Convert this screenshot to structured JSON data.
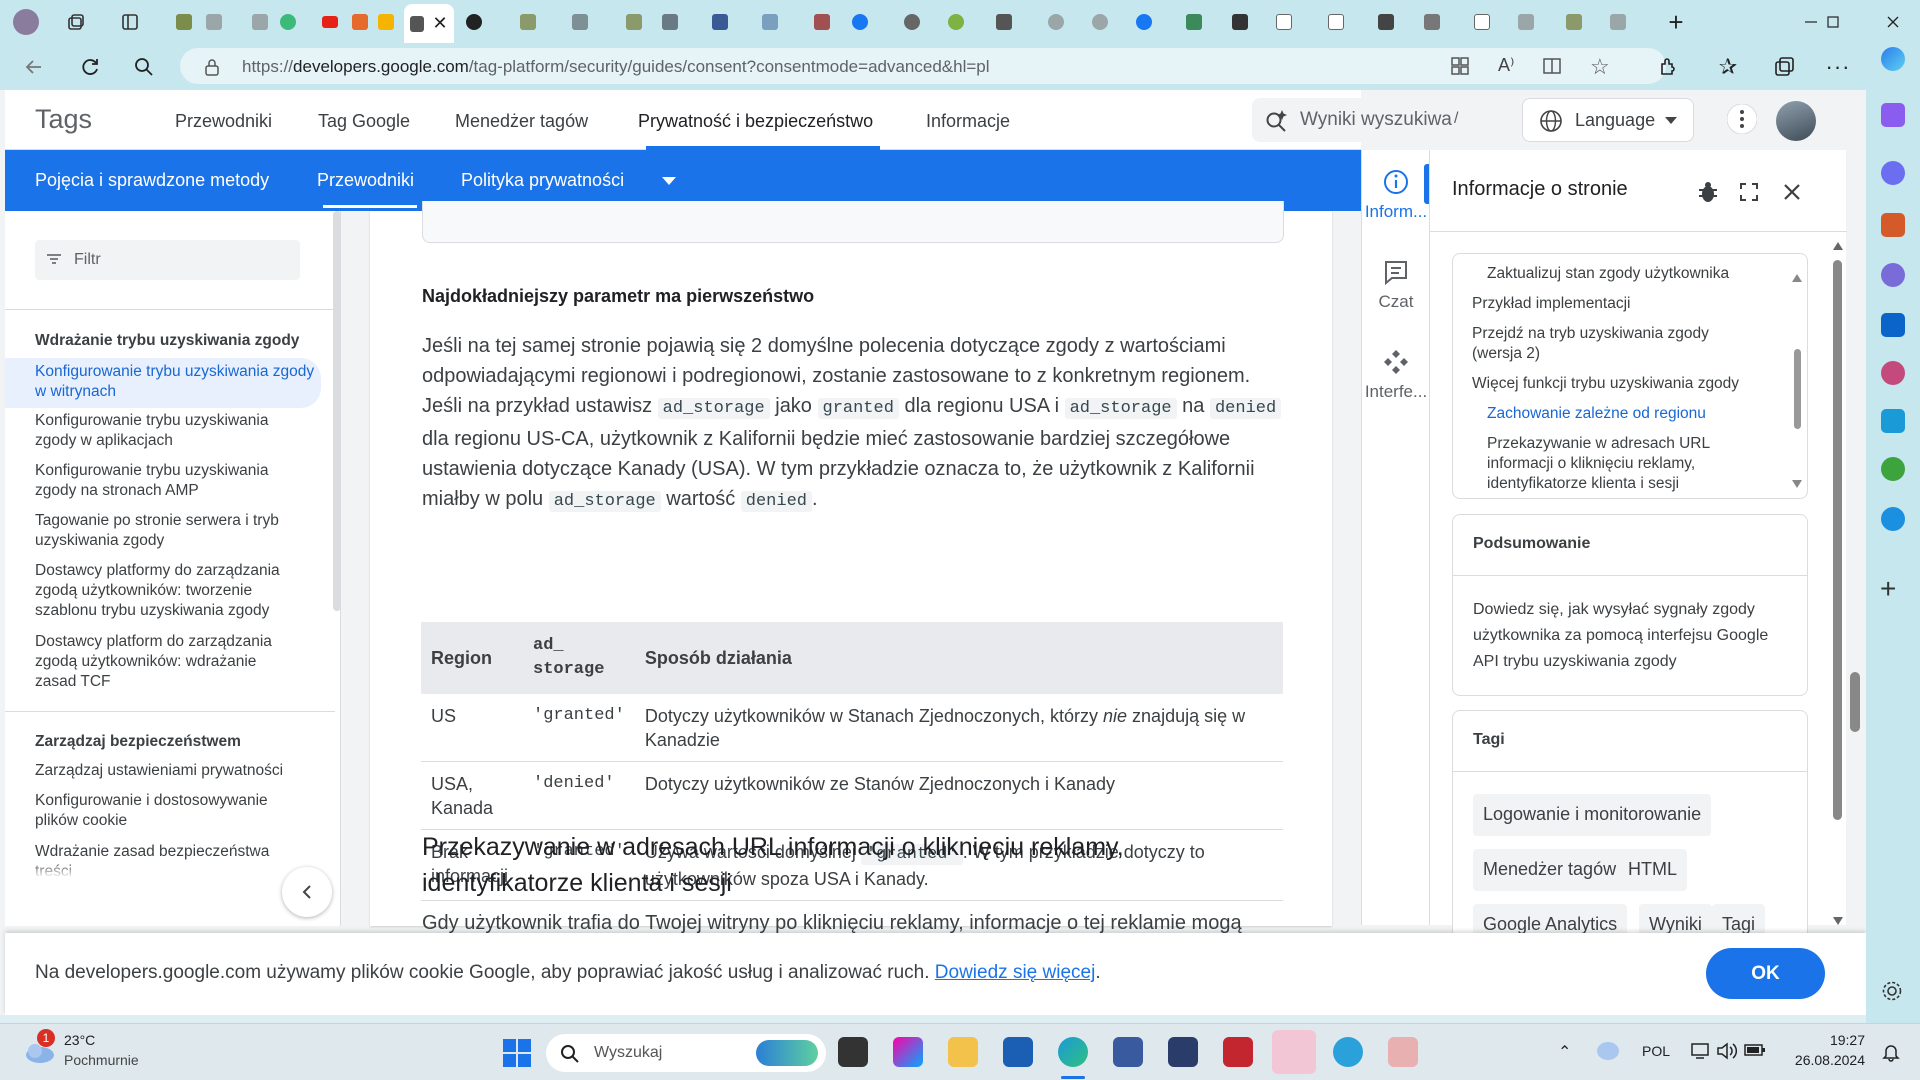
{
  "browser": {
    "url_prefix": "https://",
    "url_domain": "developers.google.com",
    "url_rest": "/tag-platform/security/guides/consent?consentmode=advanced&hl=pl"
  },
  "site": {
    "brand": "Tags",
    "top_nav": [
      "Przewodniki",
      "Tag Google",
      "Menedżer tagów",
      "Prywatność i bezpieczeństwo",
      "Informacje"
    ],
    "search_placeholder": "Wyniki wyszukiwa",
    "search_shortcut": "/",
    "language_label": "Language",
    "sub_nav": [
      "Pojęcia i sprawdzone metody",
      "Przewodniki",
      "Polityka prywatności"
    ]
  },
  "left_nav": {
    "filter_placeholder": "Filtr",
    "section1_title": "Wdrażanie trybu uzyskiwania zgody",
    "section1_items": [
      "Konfigurowanie trybu uzyskiwania zgody w witrynach",
      "Konfigurowanie trybu uzyskiwania zgody w aplikacjach",
      "Konfigurowanie trybu uzyskiwania zgody na stronach AMP",
      "Tagowanie po stronie serwera i tryb uzyskiwania zgody",
      "Dostawcy platformy do zarządzania zgodą użytkowników: tworzenie szablonu trybu uzyskiwania zgody",
      "Dostawcy platform do zarządzania zgodą użytkowników: wdrażanie zasad TCF"
    ],
    "section2_title": "Zarządzaj bezpieczeństwem",
    "section2_items": [
      "Zarządzaj ustawieniami prywatności",
      "Konfigurowanie i dostosowywanie plików cookie",
      "Wdrażanie zasad bezpieczeństwa treści"
    ]
  },
  "article": {
    "subheading": "Najdokładniejszy parametr ma pierwszeństwo",
    "p1_a": "Jeśli na tej samej stronie pojawią się 2 domyślne polecenia dotyczące zgody z wartościami odpowiadającymi regionowi i podregionowi, zostanie zastosowane to z konkretnym regionem. Jeśli na przykład ustawisz ",
    "p1_code1": "ad_storage",
    "p1_b": " jako ",
    "p1_code2": "granted",
    "p1_c": " dla regionu USA i ",
    "p1_code3": "ad_storage",
    "p1_d": " na ",
    "p1_code4": "denied",
    "p1_e": " dla regionu US-CA, użytkownik z Kalifornii będzie mieć zastosowanie bardziej szczegółowe ustawienia dotyczące Kanady (USA). W tym przykładzie oznacza to, że użytkownik z Kalifornii miałby w polu ",
    "p1_code5": "ad_storage",
    "p1_f": " wartość ",
    "p1_code6": "denied",
    "p1_g": ".",
    "table_headers": [
      "Region",
      "ad_\nstorage",
      "Sposób działania"
    ],
    "rows": [
      {
        "region": "US",
        "value": "'granted'",
        "desc_a": "Dotyczy użytkowników w Stanach Zjednoczonych, którzy ",
        "desc_em": "nie",
        "desc_b": " znajdują się w Kanadzie"
      },
      {
        "region": "USA, Kanada",
        "value": "'denied'",
        "desc_a": "Dotyczy użytkowników ze Stanów Zjednoczonych i Kanady",
        "desc_em": "",
        "desc_b": ""
      },
      {
        "region": "Brak informacji",
        "value": "'granted'",
        "desc_a": "Używa wartości domyślnej ",
        "desc_code": "'granted'",
        "desc_b": ". W tym przykładzie dotyczy to użytkowników spoza USA i Kanady."
      }
    ],
    "h2": "Przekazywanie w adresach URL informacji o kliknięciu reklamy, identyfikatorze klienta i sesji",
    "p2_partial": "Gdy użytkownik trafia do Twojej witryny po kliknięciu reklamy, informacje o tej reklamie mogą"
  },
  "side_rail": {
    "items": [
      "Inform...",
      "Czat",
      "Interfe..."
    ]
  },
  "info_panel": {
    "title": "Informacje o stronie",
    "toc": [
      "Zaktualizuj stan zgody użytkownika",
      "Przykład implementacji",
      "Przejdź na tryb uzyskiwania zgody (wersja 2)",
      "Więcej funkcji trybu uzyskiwania zgody",
      "Zachowanie zależne od regionu",
      "Przekazywanie w adresach URL informacji o kliknięciu reklamy, identyfikatorze klienta i sesji"
    ],
    "summary_title": "Podsumowanie",
    "summary_text": "Dowiedz się, jak wysyłać sygnały zgody użytkownika za pomocą interfejsu Google API trybu uzyskiwania zgody",
    "tags_title": "Tagi",
    "tags": [
      "Logowanie i monitorowanie",
      "Menedżer tagów",
      "HTML",
      "Google Analytics",
      "Wyniki",
      "Tagi"
    ]
  },
  "cookie_bar": {
    "text": "Na developers.google.com używamy plików cookie Google, aby poprawiać jakość usług i analizować ruch. ",
    "link": "Dowiedz się więcej",
    "end": ".",
    "ok": "OK"
  },
  "taskbar": {
    "weather_badge": "1",
    "temp": "23°C",
    "weather": "Pochmurnie",
    "search_placeholder": "Wyszukaj",
    "lang": "POL",
    "time": "19:27",
    "date": "26.08.2024"
  },
  "colors": {
    "accent": "#1a73e8",
    "chrome": "#c7e7ef"
  }
}
